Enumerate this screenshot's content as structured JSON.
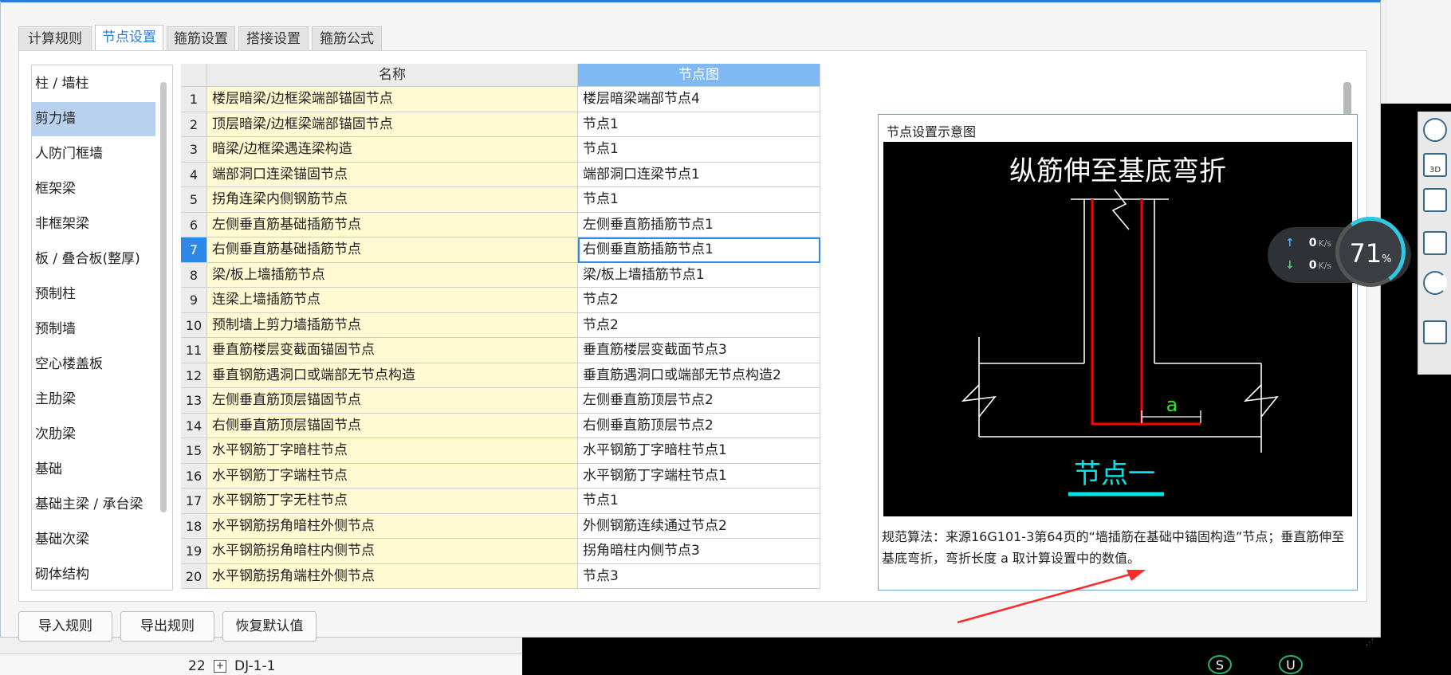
{
  "tabs": [
    {
      "label": "计算规则",
      "active": false
    },
    {
      "label": "节点设置",
      "active": true
    },
    {
      "label": "箍筋设置",
      "active": false
    },
    {
      "label": "搭接设置",
      "active": false
    },
    {
      "label": "箍筋公式",
      "active": false
    }
  ],
  "categories": [
    {
      "label": "柱 / 墙柱",
      "selected": false
    },
    {
      "label": "剪力墙",
      "selected": true
    },
    {
      "label": "人防门框墙",
      "selected": false
    },
    {
      "label": "框架梁",
      "selected": false
    },
    {
      "label": "非框架梁",
      "selected": false
    },
    {
      "label": "板 / 叠合板(整厚)",
      "selected": false
    },
    {
      "label": "预制柱",
      "selected": false
    },
    {
      "label": "预制墙",
      "selected": false
    },
    {
      "label": "空心楼盖板",
      "selected": false
    },
    {
      "label": "主肋梁",
      "selected": false
    },
    {
      "label": "次肋梁",
      "selected": false
    },
    {
      "label": "基础",
      "selected": false
    },
    {
      "label": "基础主梁 / 承台梁",
      "selected": false
    },
    {
      "label": "基础次梁",
      "selected": false
    },
    {
      "label": "砌体结构",
      "selected": false
    }
  ],
  "grid": {
    "headers": {
      "name": "名称",
      "node": "节点图"
    },
    "current_row": 7,
    "rows": [
      {
        "n": "1",
        "name": "楼层暗梁/边框梁端部锚固节点",
        "node": "楼层暗梁端部节点4"
      },
      {
        "n": "2",
        "name": "顶层暗梁/边框梁端部锚固节点",
        "node": "节点1"
      },
      {
        "n": "3",
        "name": "暗梁/边框梁遇连梁构造",
        "node": "节点1"
      },
      {
        "n": "4",
        "name": "端部洞口连梁锚固节点",
        "node": "端部洞口连梁节点1"
      },
      {
        "n": "5",
        "name": "拐角连梁内侧钢筋节点",
        "node": "节点1"
      },
      {
        "n": "6",
        "name": "左侧垂直筋基础插筋节点",
        "node": "左侧垂直筋插筋节点1"
      },
      {
        "n": "7",
        "name": "右侧垂直筋基础插筋节点",
        "node": "右侧垂直筋插筋节点1"
      },
      {
        "n": "8",
        "name": "梁/板上墙插筋节点",
        "node": "梁/板上墙插筋节点1"
      },
      {
        "n": "9",
        "name": "连梁上墙插筋节点",
        "node": "节点2"
      },
      {
        "n": "10",
        "name": "预制墙上剪力墙插筋节点",
        "node": "节点2"
      },
      {
        "n": "11",
        "name": "垂直筋楼层变截面锚固节点",
        "node": "垂直筋楼层变截面节点3"
      },
      {
        "n": "12",
        "name": "垂直钢筋遇洞口或端部无节点构造",
        "node": "垂直筋遇洞口或端部无节点构造2"
      },
      {
        "n": "13",
        "name": "左侧垂直筋顶层锚固节点",
        "node": "左侧垂直筋顶层节点2"
      },
      {
        "n": "14",
        "name": "右侧垂直筋顶层锚固节点",
        "node": "右侧垂直筋顶层节点2"
      },
      {
        "n": "15",
        "name": "水平钢筋丁字暗柱节点",
        "node": "水平钢筋丁字暗柱节点1"
      },
      {
        "n": "16",
        "name": "水平钢筋丁字端柱节点",
        "node": "水平钢筋丁字端柱节点1"
      },
      {
        "n": "17",
        "name": "水平钢筋丁字无柱节点",
        "node": "节点1"
      },
      {
        "n": "18",
        "name": "水平钢筋拐角暗柱外侧节点",
        "node": "外侧钢筋连续通过节点2"
      },
      {
        "n": "19",
        "name": "水平钢筋拐角暗柱内侧节点",
        "node": "拐角暗柱内侧节点3"
      },
      {
        "n": "20",
        "name": "水平钢筋拐角端柱外侧节点",
        "node": "节点3"
      }
    ]
  },
  "preview": {
    "title": "节点设置示意图",
    "diagram_title": "纵筋伸至基底弯折",
    "dim_label": "a",
    "node_caption": "节点一",
    "description": "规范算法：来源16G101-3第64页的“墙插筋在基础中锚固构造”节点；垂直筋伸至基底弯折，弯折长度 a 取计算设置中的数值。"
  },
  "buttons": {
    "import": "导入规则",
    "export": "导出规则",
    "restore": "恢复默认值"
  },
  "speed_widget": {
    "up": "0",
    "down": "0",
    "unit": "K/s",
    "percent": "71",
    "percent_sign": "%"
  },
  "background": {
    "row_num": "22",
    "row_plus": "+",
    "row_name": "DJ-1-1",
    "circle_s": "S",
    "circle_u": "U",
    "toolbar_3d": "3D"
  },
  "colors": {
    "accent": "#2d7bd6",
    "header_node": "#7fb8f3",
    "name_cell": "#fffad2",
    "selected_category": "#b8d1ee",
    "rebar_red": "#ff0000",
    "caption_cyan": "#00e5e5"
  }
}
